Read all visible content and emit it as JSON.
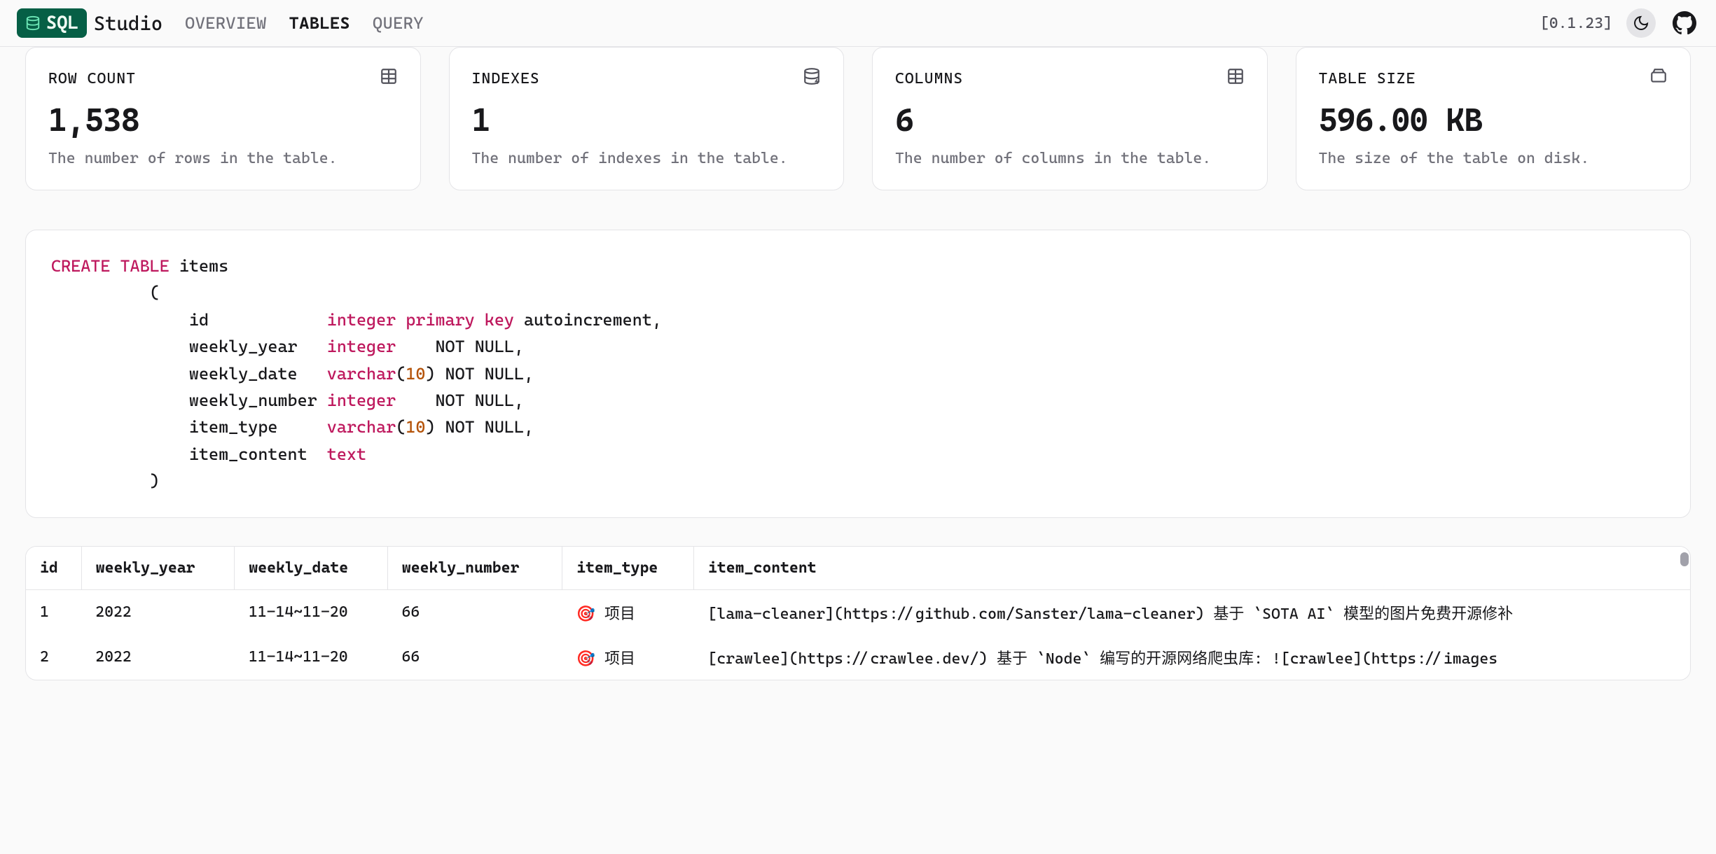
{
  "brand": {
    "badge": "SQL",
    "text": "Studio"
  },
  "nav": {
    "overview": "OVERVIEW",
    "tables": "TABLES",
    "query": "QUERY"
  },
  "version": "[0.1.23]",
  "cards": {
    "rowcount": {
      "label": "ROW COUNT",
      "value": "1,538",
      "desc": "The number of rows in the table."
    },
    "indexes": {
      "label": "INDEXES",
      "value": "1",
      "desc": "The number of indexes in the table."
    },
    "columns": {
      "label": "COLUMNS",
      "value": "6",
      "desc": "The number of columns in the table."
    },
    "size": {
      "label": "TABLE SIZE",
      "value": "596.00 KB",
      "desc": "The size of the table on disk."
    }
  },
  "sql": {
    "create": "CREATE TABLE",
    "tablename": "items",
    "cols": {
      "id": {
        "name": "id",
        "type": "integer",
        "extra1": "primary key",
        "extra2": " autoincrement,"
      },
      "weekly_year": {
        "name": "weekly_year",
        "type": "integer",
        "tail": "    NOT NULL,"
      },
      "weekly_date": {
        "name": "weekly_date",
        "type": "varchar",
        "size": "10",
        "tail": " NOT NULL,"
      },
      "weekly_number": {
        "name": "weekly_number",
        "type": "integer",
        "tail": "    NOT NULL,"
      },
      "item_type": {
        "name": "item_type",
        "type": "varchar",
        "size": "10",
        "tail": " NOT NULL,"
      },
      "item_content": {
        "name": "item_content",
        "type": "text"
      }
    }
  },
  "table": {
    "headers": {
      "id": "id",
      "weekly_year": "weekly_year",
      "weekly_date": "weekly_date",
      "weekly_number": "weekly_number",
      "item_type": "item_type",
      "item_content": "item_content"
    },
    "rows": [
      {
        "id": "1",
        "weekly_year": "2022",
        "weekly_date": "11-14~11-20",
        "weekly_number": "66",
        "item_type": "🎯 项目",
        "item_content": "[lama-cleaner](https://github.com/Sanster/lama-cleaner) 基于 `SOTA AI` 模型的图片免费开源修补"
      },
      {
        "id": "2",
        "weekly_year": "2022",
        "weekly_date": "11-14~11-20",
        "weekly_number": "66",
        "item_type": "🎯 项目",
        "item_content": "[crawlee](https://crawlee.dev/) 基于 `Node` 编写的开源网络爬虫库:  ![crawlee](https://images"
      }
    ]
  }
}
